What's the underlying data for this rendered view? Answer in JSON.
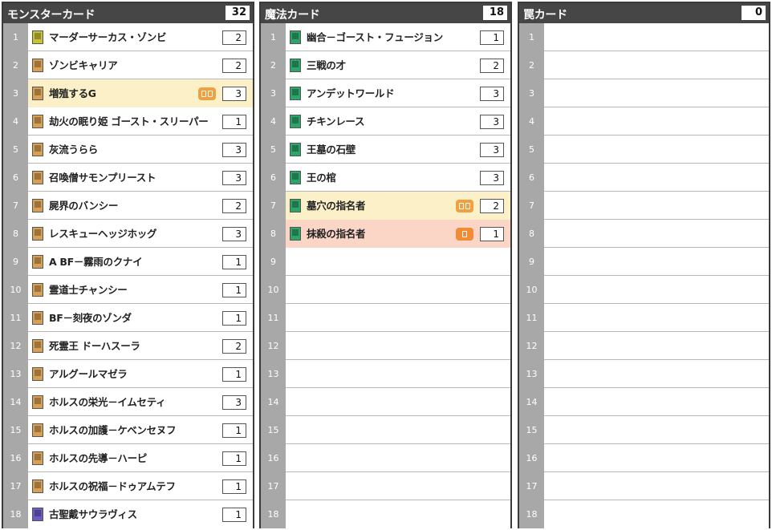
{
  "colors": {
    "header_bg": "#464646",
    "row_num_bg": "#a8a8a8",
    "monster_effect": "#d8a055",
    "monster_normal": "#c8c238",
    "monster_fusion": "#6a5cc4",
    "spell": "#2ea36a",
    "highlight_semi_limited": "#fcf0c8",
    "highlight_limited": "#fbd5c6",
    "limit_badge": "#f0a040"
  },
  "panels": [
    {
      "title": "モンスターカード",
      "count": "32",
      "rows": [
        {
          "num": "1",
          "name": "マーダーサーカス・ゾンビ",
          "qty": "2",
          "icon": "monster-normal-card-icon",
          "icon_color": "#c8c238",
          "highlight": "",
          "badge": ""
        },
        {
          "num": "2",
          "name": "ゾンビキャリア",
          "qty": "2",
          "icon": "monster-effect-card-icon",
          "icon_color": "#d8a055",
          "highlight": "",
          "badge": ""
        },
        {
          "num": "3",
          "name": "増殖するG",
          "qty": "3",
          "icon": "monster-effect-card-icon",
          "icon_color": "#d8a055",
          "highlight": "yellow",
          "badge": "semi"
        },
        {
          "num": "4",
          "name": "劫火の眠り姫 ゴースト・スリーパー",
          "qty": "1",
          "icon": "monster-effect-card-icon",
          "icon_color": "#d8a055",
          "highlight": "",
          "badge": ""
        },
        {
          "num": "5",
          "name": "灰流うらら",
          "qty": "3",
          "icon": "monster-effect-card-icon",
          "icon_color": "#d8a055",
          "highlight": "",
          "badge": ""
        },
        {
          "num": "6",
          "name": "召喚僧サモンプリースト",
          "qty": "3",
          "icon": "monster-effect-card-icon",
          "icon_color": "#d8a055",
          "highlight": "",
          "badge": ""
        },
        {
          "num": "7",
          "name": "屍界のバンシー",
          "qty": "2",
          "icon": "monster-effect-card-icon",
          "icon_color": "#d8a055",
          "highlight": "",
          "badge": ""
        },
        {
          "num": "8",
          "name": "レスキューヘッジホッグ",
          "qty": "3",
          "icon": "monster-effect-card-icon",
          "icon_color": "#d8a055",
          "highlight": "",
          "badge": ""
        },
        {
          "num": "9",
          "name": "A BF－霧雨のクナイ",
          "qty": "1",
          "icon": "monster-effect-card-icon",
          "icon_color": "#d8a055",
          "highlight": "",
          "badge": ""
        },
        {
          "num": "10",
          "name": "霊道士チャンシー",
          "qty": "1",
          "icon": "monster-effect-card-icon",
          "icon_color": "#d8a055",
          "highlight": "",
          "badge": ""
        },
        {
          "num": "11",
          "name": "BF－刻夜のゾンダ",
          "qty": "1",
          "icon": "monster-effect-card-icon",
          "icon_color": "#d8a055",
          "highlight": "",
          "badge": ""
        },
        {
          "num": "12",
          "name": "死霊王 ドーハスーラ",
          "qty": "2",
          "icon": "monster-effect-card-icon",
          "icon_color": "#d8a055",
          "highlight": "",
          "badge": ""
        },
        {
          "num": "13",
          "name": "アルグールマゼラ",
          "qty": "1",
          "icon": "monster-effect-card-icon",
          "icon_color": "#d8a055",
          "highlight": "",
          "badge": ""
        },
        {
          "num": "14",
          "name": "ホルスの栄光－イムセティ",
          "qty": "3",
          "icon": "monster-effect-card-icon",
          "icon_color": "#d8a055",
          "highlight": "",
          "badge": ""
        },
        {
          "num": "15",
          "name": "ホルスの加護－ケベンセヌフ",
          "qty": "1",
          "icon": "monster-effect-card-icon",
          "icon_color": "#d8a055",
          "highlight": "",
          "badge": ""
        },
        {
          "num": "16",
          "name": "ホルスの先導－ハーピ",
          "qty": "1",
          "icon": "monster-effect-card-icon",
          "icon_color": "#d8a055",
          "highlight": "",
          "badge": ""
        },
        {
          "num": "17",
          "name": "ホルスの祝福－ドゥアムテフ",
          "qty": "1",
          "icon": "monster-effect-card-icon",
          "icon_color": "#d8a055",
          "highlight": "",
          "badge": ""
        },
        {
          "num": "18",
          "name": "古聖戴サウラヴィス",
          "qty": "1",
          "icon": "monster-fusion-card-icon",
          "icon_color": "#6a5cc4",
          "highlight": "",
          "badge": ""
        }
      ]
    },
    {
      "title": "魔法カード",
      "count": "18",
      "rows": [
        {
          "num": "1",
          "name": "幽合－ゴースト・フュージョン",
          "qty": "1",
          "icon": "spell-card-icon",
          "icon_color": "#2ea36a",
          "highlight": "",
          "badge": ""
        },
        {
          "num": "2",
          "name": "三戦の才",
          "qty": "2",
          "icon": "spell-card-icon",
          "icon_color": "#2ea36a",
          "highlight": "",
          "badge": ""
        },
        {
          "num": "3",
          "name": "アンデットワールド",
          "qty": "3",
          "icon": "spell-card-icon",
          "icon_color": "#2ea36a",
          "highlight": "",
          "badge": ""
        },
        {
          "num": "4",
          "name": "チキンレース",
          "qty": "3",
          "icon": "spell-card-icon",
          "icon_color": "#2ea36a",
          "highlight": "",
          "badge": ""
        },
        {
          "num": "5",
          "name": "王墓の石壁",
          "qty": "3",
          "icon": "spell-card-icon",
          "icon_color": "#2ea36a",
          "highlight": "",
          "badge": ""
        },
        {
          "num": "6",
          "name": "王の棺",
          "qty": "3",
          "icon": "spell-card-icon",
          "icon_color": "#2ea36a",
          "highlight": "",
          "badge": ""
        },
        {
          "num": "7",
          "name": "墓穴の指名者",
          "qty": "2",
          "icon": "spell-card-icon",
          "icon_color": "#2ea36a",
          "highlight": "yellow",
          "badge": "semi"
        },
        {
          "num": "8",
          "name": "抹殺の指名者",
          "qty": "1",
          "icon": "spell-card-icon",
          "icon_color": "#2ea36a",
          "highlight": "red",
          "badge": "limited"
        },
        {
          "num": "9",
          "name": "",
          "qty": "",
          "icon": "",
          "icon_color": "",
          "highlight": "",
          "badge": ""
        },
        {
          "num": "10",
          "name": "",
          "qty": "",
          "icon": "",
          "icon_color": "",
          "highlight": "",
          "badge": ""
        },
        {
          "num": "11",
          "name": "",
          "qty": "",
          "icon": "",
          "icon_color": "",
          "highlight": "",
          "badge": ""
        },
        {
          "num": "12",
          "name": "",
          "qty": "",
          "icon": "",
          "icon_color": "",
          "highlight": "",
          "badge": ""
        },
        {
          "num": "13",
          "name": "",
          "qty": "",
          "icon": "",
          "icon_color": "",
          "highlight": "",
          "badge": ""
        },
        {
          "num": "14",
          "name": "",
          "qty": "",
          "icon": "",
          "icon_color": "",
          "highlight": "",
          "badge": ""
        },
        {
          "num": "15",
          "name": "",
          "qty": "",
          "icon": "",
          "icon_color": "",
          "highlight": "",
          "badge": ""
        },
        {
          "num": "16",
          "name": "",
          "qty": "",
          "icon": "",
          "icon_color": "",
          "highlight": "",
          "badge": ""
        },
        {
          "num": "17",
          "name": "",
          "qty": "",
          "icon": "",
          "icon_color": "",
          "highlight": "",
          "badge": ""
        },
        {
          "num": "18",
          "name": "",
          "qty": "",
          "icon": "",
          "icon_color": "",
          "highlight": "",
          "badge": ""
        }
      ]
    },
    {
      "title": "罠カード",
      "count": "0",
      "rows": [
        {
          "num": "1",
          "name": "",
          "qty": "",
          "icon": "",
          "icon_color": "",
          "highlight": "",
          "badge": ""
        },
        {
          "num": "2",
          "name": "",
          "qty": "",
          "icon": "",
          "icon_color": "",
          "highlight": "",
          "badge": ""
        },
        {
          "num": "3",
          "name": "",
          "qty": "",
          "icon": "",
          "icon_color": "",
          "highlight": "",
          "badge": ""
        },
        {
          "num": "4",
          "name": "",
          "qty": "",
          "icon": "",
          "icon_color": "",
          "highlight": "",
          "badge": ""
        },
        {
          "num": "5",
          "name": "",
          "qty": "",
          "icon": "",
          "icon_color": "",
          "highlight": "",
          "badge": ""
        },
        {
          "num": "6",
          "name": "",
          "qty": "",
          "icon": "",
          "icon_color": "",
          "highlight": "",
          "badge": ""
        },
        {
          "num": "7",
          "name": "",
          "qty": "",
          "icon": "",
          "icon_color": "",
          "highlight": "",
          "badge": ""
        },
        {
          "num": "8",
          "name": "",
          "qty": "",
          "icon": "",
          "icon_color": "",
          "highlight": "",
          "badge": ""
        },
        {
          "num": "9",
          "name": "",
          "qty": "",
          "icon": "",
          "icon_color": "",
          "highlight": "",
          "badge": ""
        },
        {
          "num": "10",
          "name": "",
          "qty": "",
          "icon": "",
          "icon_color": "",
          "highlight": "",
          "badge": ""
        },
        {
          "num": "11",
          "name": "",
          "qty": "",
          "icon": "",
          "icon_color": "",
          "highlight": "",
          "badge": ""
        },
        {
          "num": "12",
          "name": "",
          "qty": "",
          "icon": "",
          "icon_color": "",
          "highlight": "",
          "badge": ""
        },
        {
          "num": "13",
          "name": "",
          "qty": "",
          "icon": "",
          "icon_color": "",
          "highlight": "",
          "badge": ""
        },
        {
          "num": "14",
          "name": "",
          "qty": "",
          "icon": "",
          "icon_color": "",
          "highlight": "",
          "badge": ""
        },
        {
          "num": "15",
          "name": "",
          "qty": "",
          "icon": "",
          "icon_color": "",
          "highlight": "",
          "badge": ""
        },
        {
          "num": "16",
          "name": "",
          "qty": "",
          "icon": "",
          "icon_color": "",
          "highlight": "",
          "badge": ""
        },
        {
          "num": "17",
          "name": "",
          "qty": "",
          "icon": "",
          "icon_color": "",
          "highlight": "",
          "badge": ""
        },
        {
          "num": "18",
          "name": "",
          "qty": "",
          "icon": "",
          "icon_color": "",
          "highlight": "",
          "badge": ""
        }
      ]
    }
  ]
}
